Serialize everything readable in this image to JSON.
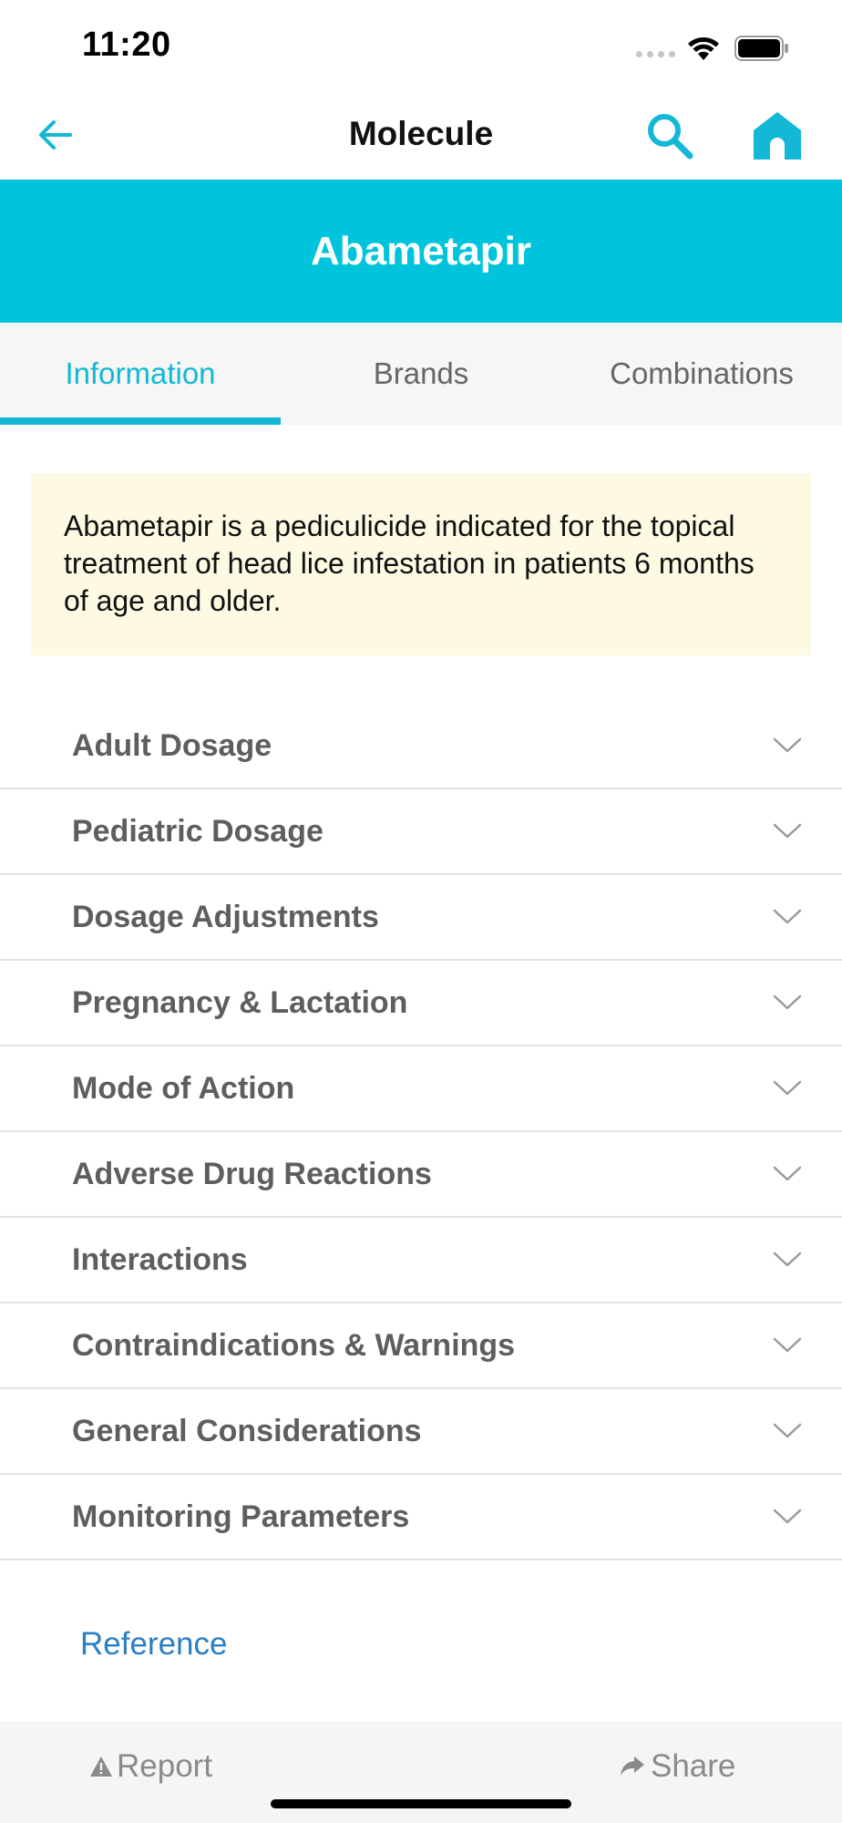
{
  "status_bar": {
    "time": "11:20",
    "icons": [
      "cellular-signal-icon",
      "wifi-icon",
      "battery-icon"
    ]
  },
  "nav": {
    "title": "Molecule",
    "back_icon": "arrow-left-icon",
    "search_icon": "search-icon",
    "home_icon": "home-icon"
  },
  "hero": {
    "title": "Abametapir"
  },
  "tabs": [
    {
      "label": "Information",
      "active": true
    },
    {
      "label": "Brands",
      "active": false
    },
    {
      "label": "Combinations",
      "active": false
    }
  ],
  "summary": {
    "text": "Abametapir is a pediculicide indicated for the topical treatment of head lice infestation in patients 6 months of age and older."
  },
  "sections": [
    {
      "label": "Adult Dosage"
    },
    {
      "label": "Pediatric Dosage"
    },
    {
      "label": "Dosage Adjustments"
    },
    {
      "label": "Pregnancy & Lactation"
    },
    {
      "label": "Mode of Action"
    },
    {
      "label": "Adverse Drug Reactions"
    },
    {
      "label": "Interactions"
    },
    {
      "label": "Contraindications & Warnings"
    },
    {
      "label": "General Considerations"
    },
    {
      "label": "Monitoring Parameters"
    }
  ],
  "reference": {
    "label": "Reference"
  },
  "bottom_bar": {
    "report_label": "Report",
    "report_icon": "warning-triangle-icon",
    "share_label": "Share",
    "share_icon": "share-arrow-icon"
  },
  "colors": {
    "accent": "#13b8d6",
    "hero_background": "#00c4dc",
    "summary_background": "#fdf9e3",
    "link": "#2b7fc3"
  }
}
